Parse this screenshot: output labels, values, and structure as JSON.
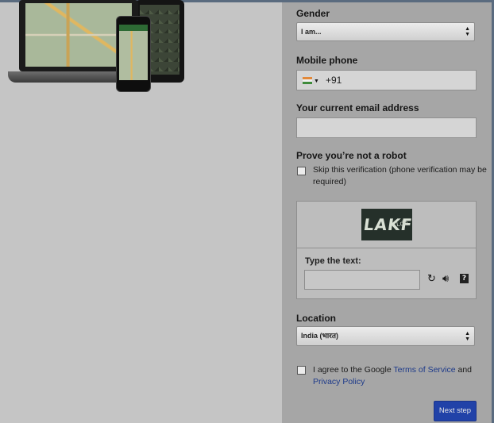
{
  "form": {
    "gender_label": "Gender",
    "gender_value": "I am...",
    "mobile_label": "Mobile phone",
    "phone_code": "+91",
    "email_label": "Your current email address",
    "email_value": "",
    "robot_label": "Prove you’re not a robot",
    "skip_line1": "Skip this verification (phone verification may be",
    "skip_line2": "required)",
    "captcha_word": "LAKF",
    "captcha_word_small": "Ldo",
    "type_text_label": "Type the text:",
    "captcha_value": "",
    "location_label": "Location",
    "location_value": "India (भारत)",
    "agree_prefix": "I agree to the Google ",
    "terms_link": "Terms of Service",
    "agree_and": " and",
    "privacy_link": "Privacy Policy",
    "next_button": "Next step"
  },
  "icons": {
    "refresh": "refresh-icon",
    "audio": "speaker-icon",
    "help": "help-icon",
    "flag": "india-flag-icon"
  },
  "colors": {
    "panel": "#a6a6a6",
    "page_background": "#c5c5c5",
    "link": "#1d3a8a",
    "primary_button": "#2142a8"
  }
}
